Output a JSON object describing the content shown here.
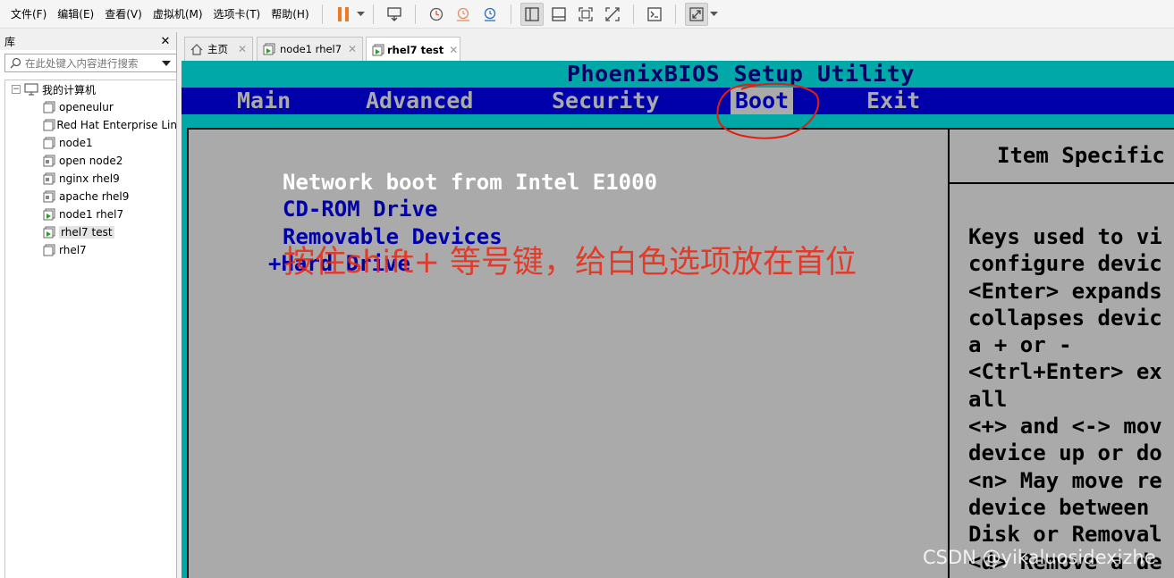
{
  "menubar": {
    "items": [
      "文件(F)",
      "编辑(E)",
      "查看(V)",
      "虚拟机(M)",
      "选项卡(T)",
      "帮助(H)"
    ]
  },
  "library": {
    "title": "库",
    "search_placeholder": "在此处键入内容进行搜索",
    "root": "我的计算机",
    "vms": [
      "openeulur",
      "Red Hat Enterprise Lin",
      "node1",
      "open node2",
      "nginx rhel9",
      "apache rhel9",
      "node1 rhel7",
      "rhel7 test",
      "rhel7"
    ],
    "selected": "rhel7 test"
  },
  "tabs": [
    {
      "label": "主页"
    },
    {
      "label": "node1 rhel7"
    },
    {
      "label": "rhel7 test"
    }
  ],
  "bios": {
    "title": "PhoenixBIOS Setup Utility",
    "menus": [
      "Main",
      "Advanced",
      "Security",
      "Boot",
      "Exit"
    ],
    "active_menu": "Boot",
    "boot_items": [
      "Network boot from Intel E1000",
      "CD-ROM Drive",
      "Removable Devices",
      "+Hard Drive"
    ],
    "selected_boot_item": "Network boot from Intel E1000",
    "help_title": "Item Specific",
    "help_lines": [
      "Keys used to vi",
      "configure devic",
      "<Enter> expands",
      "collapses devic",
      "a + or -",
      "<Ctrl+Enter> ex",
      "all",
      "<+> and <-> mov",
      "device up or do",
      "<n> May move re",
      "device between",
      "Disk or Removal",
      "<d> Remove a de"
    ],
    "colors": {
      "screen": "#00a8a8",
      "menubar": "#0000aa",
      "panel": "#aaaaaa",
      "text": "#0000aa"
    }
  },
  "annotation": {
    "text": "按住shift+ 等号键，给白色选项放在首位",
    "color": "#eb2814"
  },
  "watermark": "CSDN @yikaluosidexizhe"
}
